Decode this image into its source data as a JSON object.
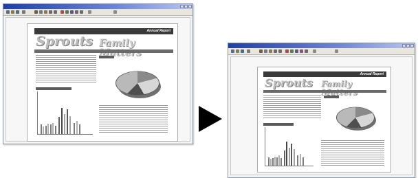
{
  "screens": {
    "before": {
      "header_text": "Annual Report",
      "logo_text": "Sprouts",
      "tagline_text": "Family Matters"
    },
    "after": {
      "header_text": "Annual Report",
      "logo_text": "Sprouts",
      "tagline_text": "Family Matters"
    }
  },
  "arrow": {
    "icon": "right-arrow-icon",
    "direction": "right"
  },
  "colors": {
    "titlebar": "#1f3fa8",
    "page": "#ffffff",
    "ink": "#3a3a3a"
  }
}
